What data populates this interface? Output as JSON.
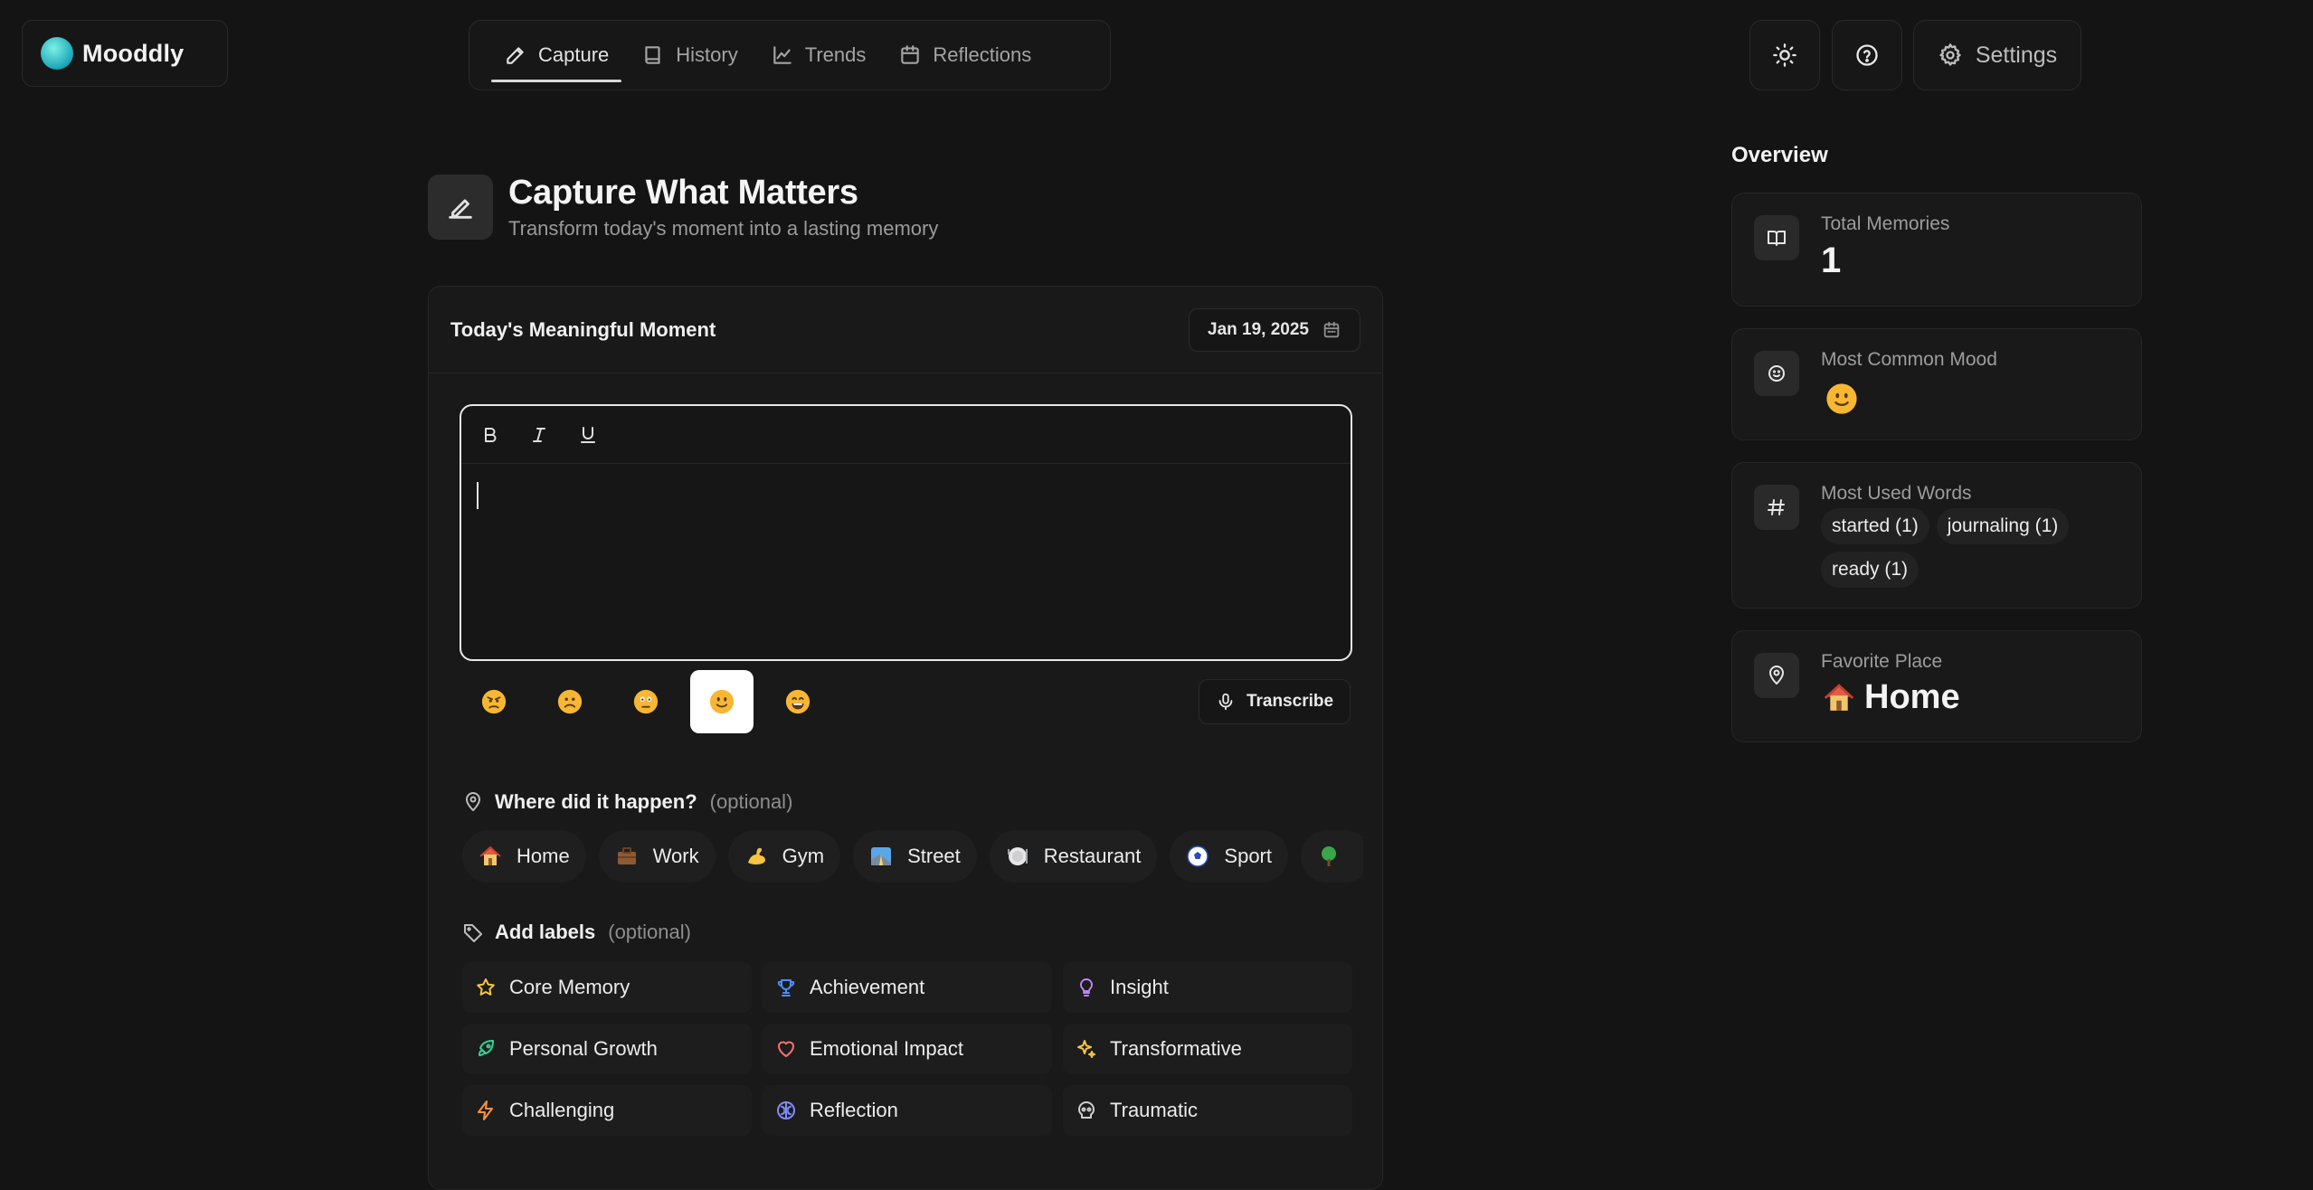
{
  "app": {
    "name": "Mooddly"
  },
  "nav": {
    "tabs": [
      {
        "label": "Capture",
        "icon": "pencil-icon",
        "active": true
      },
      {
        "label": "History",
        "icon": "book-icon",
        "active": false
      },
      {
        "label": "Trends",
        "icon": "chart-line-icon",
        "active": false
      },
      {
        "label": "Reflections",
        "icon": "calendar-icon",
        "active": false
      }
    ]
  },
  "toolbar": {
    "settings_label": "Settings",
    "theme_icon": "sun-icon",
    "help_icon": "help-circle-icon"
  },
  "page": {
    "title": "Capture What Matters",
    "subtitle": "Transform today's moment into a lasting memory"
  },
  "card": {
    "title": "Today's Meaningful Moment",
    "date": "Jan 19, 2025"
  },
  "editor": {
    "buttons": [
      "bold",
      "italic",
      "underline"
    ],
    "content": ""
  },
  "moods": {
    "options": [
      "angry",
      "sad",
      "worried",
      "neutral-smile",
      "happy"
    ],
    "selected": "neutral-smile"
  },
  "transcribe_label": "Transcribe",
  "location": {
    "label": "Where did it happen?",
    "optional": "(optional)",
    "places": [
      {
        "label": "Home",
        "emoji": "🏠"
      },
      {
        "label": "Work",
        "emoji": "💼"
      },
      {
        "label": "Gym",
        "emoji": "💪"
      },
      {
        "label": "Street",
        "emoji": "🌁"
      },
      {
        "label": "Restaurant",
        "emoji": "🍽"
      },
      {
        "label": "Sport",
        "emoji": "⚽"
      },
      {
        "label": "",
        "emoji": "🌳"
      }
    ]
  },
  "labels": {
    "label": "Add labels",
    "optional": "(optional)",
    "items": [
      {
        "label": "Core Memory",
        "icon": "star-icon",
        "color": "#f5c542"
      },
      {
        "label": "Achievement",
        "icon": "trophy-icon",
        "color": "#4f8df7"
      },
      {
        "label": "Insight",
        "icon": "lightbulb-icon",
        "color": "#c084fc"
      },
      {
        "label": "Personal Growth",
        "icon": "rocket-icon",
        "color": "#34d399"
      },
      {
        "label": "Emotional Impact",
        "icon": "heart-icon",
        "color": "#f87171"
      },
      {
        "label": "Transformative",
        "icon": "sparkles-icon",
        "color": "#f5c542"
      },
      {
        "label": "Challenging",
        "icon": "zap-icon",
        "color": "#fb923c"
      },
      {
        "label": "Reflection",
        "icon": "brain-icon",
        "color": "#818cf8"
      },
      {
        "label": "Traumatic",
        "icon": "skull-icon",
        "color": "#cfcfcf"
      }
    ]
  },
  "overview": {
    "title": "Overview",
    "total_memories": {
      "label": "Total Memories",
      "value": "1"
    },
    "common_mood": {
      "label": "Most Common Mood",
      "value": "neutral-smile"
    },
    "used_words": {
      "label": "Most Used Words",
      "words": [
        "started (1)",
        "journaling (1)",
        "ready (1)"
      ]
    },
    "favorite_place": {
      "label": "Favorite Place",
      "emoji": "🏠",
      "value": "Home"
    }
  }
}
